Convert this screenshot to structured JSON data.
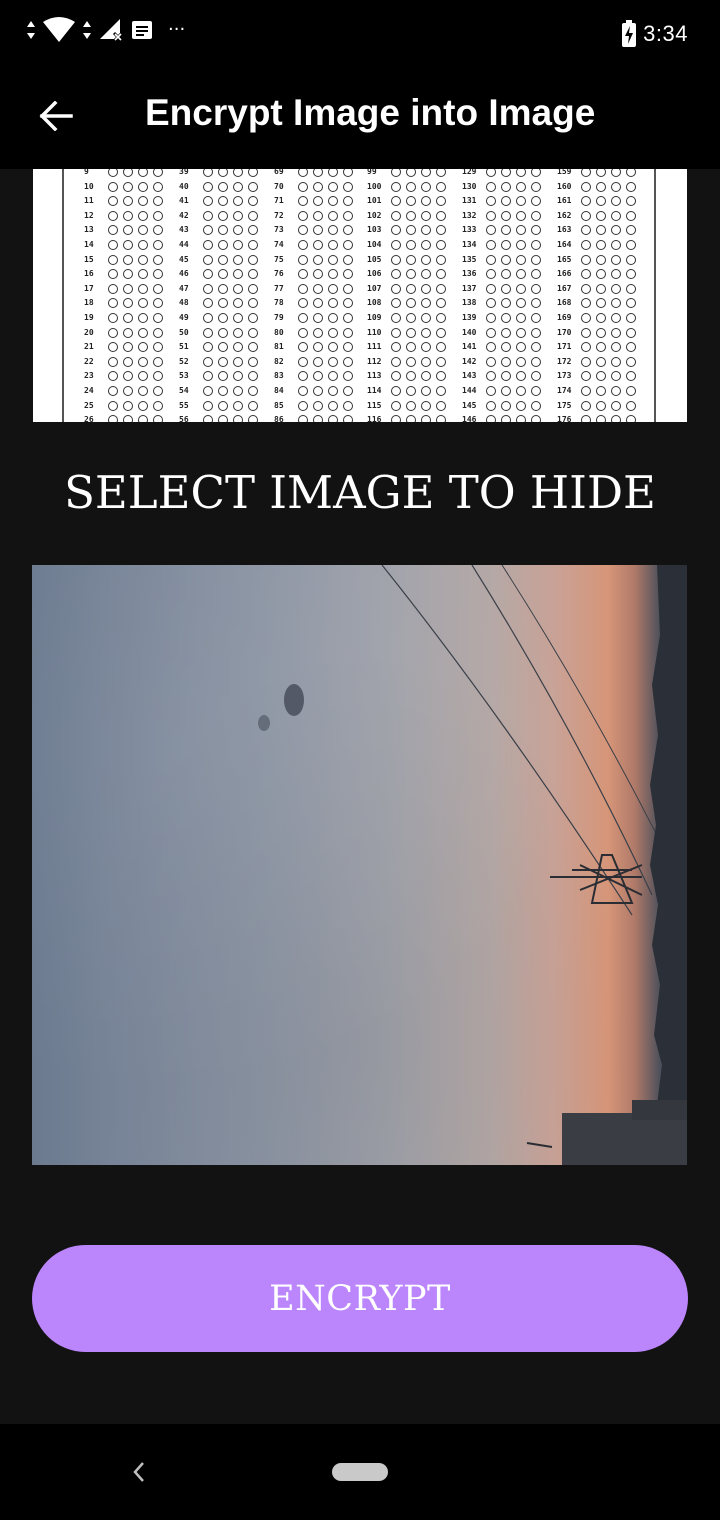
{
  "status_bar": {
    "time": "3:34",
    "icons": [
      "data-arrows-icon",
      "wifi-icon",
      "data-arrows-icon",
      "no-signal-icon",
      "message-icon",
      "more-notifications-icon",
      "battery-charging-icon"
    ],
    "overflow": "···"
  },
  "app_bar": {
    "title": "Encrypt Image into Image",
    "back_icon": "arrow-left-icon"
  },
  "cover_image": {
    "description_icon": "answer-sheet-image",
    "column_starts": [
      9,
      39,
      69,
      99,
      129,
      159
    ],
    "visible_rows": 18
  },
  "select_prompt": "SELECT IMAGE TO HIDE",
  "secret_image": {
    "description_icon": "sky-photo-image"
  },
  "encrypt_button": {
    "label": "ENCRYPT",
    "color": "#bb86fc"
  },
  "nav_bar": {
    "back_icon": "nav-back-icon",
    "home_icon": "nav-home-pill"
  },
  "colors": {
    "background": "#121212",
    "bars": "#000000",
    "accent": "#bb86fc",
    "text": "#ffffff"
  }
}
